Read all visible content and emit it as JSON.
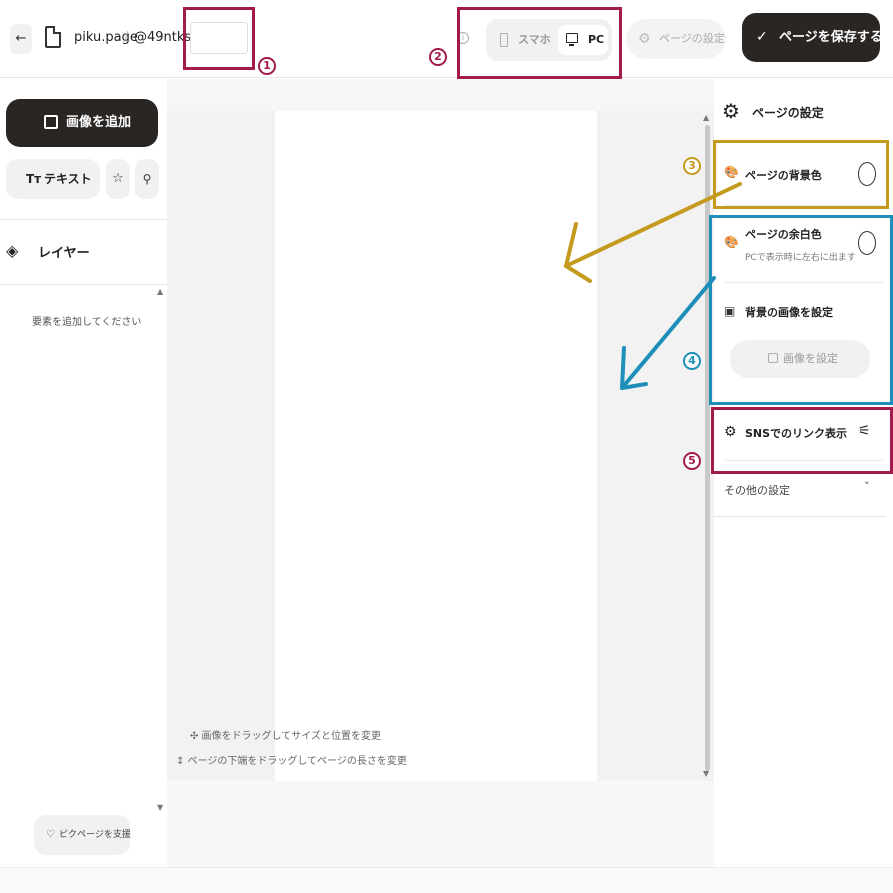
{
  "topbar": {
    "back_icon": "arrow-left-icon",
    "back_glyph": "←",
    "site_name": "piku.page",
    "separator": "/",
    "username": "@49ntks",
    "info_glyph": "i",
    "device_toggle": {
      "sp_label": "スマホ",
      "pc_label": "PC",
      "selected": "PC"
    },
    "page_settings_label": "ページの設定",
    "save_label": "ページを保存する",
    "check_glyph": "✓",
    "gear_glyph": "⚙"
  },
  "left_panel": {
    "add_image_label": "画像を追加",
    "text_label": "テキスト",
    "tt_glyph": "Tт",
    "star_glyph": "☆",
    "pin_glyph": "⚲",
    "layer_title": "レイヤー",
    "layer_glyph": "◈",
    "layer_empty": "要素を追加してください",
    "support_label": "ピクページを支援",
    "heart_glyph": "♡",
    "scroll_up": "▲",
    "scroll_down": "▼"
  },
  "canvas": {
    "hint_drag_resize": "✣ 画像をドラッグしてサイズと位置を変更",
    "hint_drag_length": "↕ ページの下端をドラッグしてページの長さを変更",
    "scroll_up": "▲",
    "scroll_down": "▼"
  },
  "right_panel": {
    "title": "ページの設定",
    "gear_glyph": "⚙",
    "palette_glyph": "🎨",
    "bg_color_label": "ページの背景色",
    "margin_color_label": "ページの余白色",
    "margin_color_sub": "PCで表示時に左右に出ます",
    "bg_image_label": "背景の画像を設定",
    "image_glyph": "▣",
    "set_image_label": "画像を設定",
    "sns_label": "SNSでのリンク表示",
    "adjust_glyph": "⚟",
    "other_label": "その他の設定",
    "chevron_glyph": "˅"
  },
  "annotations": {
    "n1": "1",
    "n2": "2",
    "n3": "3",
    "n4": "4",
    "n5": "5",
    "colors": {
      "maroon": "#a31a4d",
      "gold": "#c49b1f",
      "blue": "#1d8fb8"
    }
  }
}
